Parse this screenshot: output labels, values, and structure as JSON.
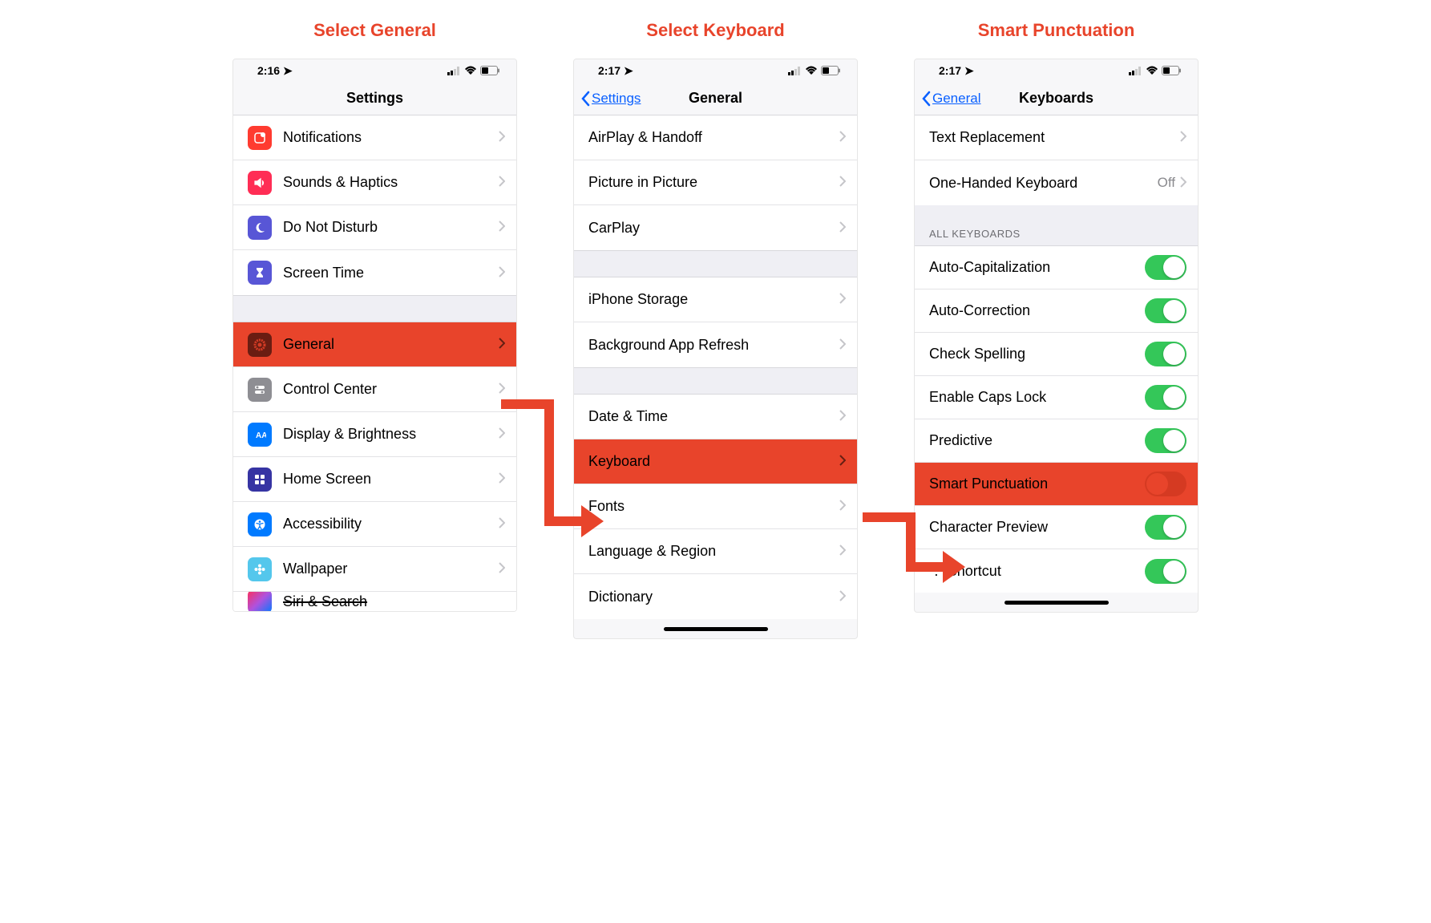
{
  "captions": {
    "c1": "Select General",
    "c2": "Select Keyboard",
    "c3": "Smart Punctuation"
  },
  "status": {
    "t1": "2:16",
    "t2": "2:17",
    "t3": "2:17"
  },
  "nav": {
    "settings_title": "Settings",
    "general_title": "General",
    "keyboards_title": "Keyboards",
    "back_settings": "Settings",
    "back_general": "General"
  },
  "screen1": {
    "notifications": "Notifications",
    "sounds": "Sounds & Haptics",
    "dnd": "Do Not Disturb",
    "screentime": "Screen Time",
    "general": "General",
    "control": "Control Center",
    "display": "Display & Brightness",
    "home": "Home Screen",
    "access": "Accessibility",
    "wallpaper": "Wallpaper",
    "siri": "Siri & Search"
  },
  "screen2": {
    "airplay": "AirPlay & Handoff",
    "pip": "Picture in Picture",
    "carplay": "CarPlay",
    "storage": "iPhone Storage",
    "bgrefresh": "Background App Refresh",
    "datetime": "Date & Time",
    "keyboard": "Keyboard",
    "fonts": "Fonts",
    "language": "Language & Region",
    "dictionary": "Dictionary"
  },
  "screen3": {
    "textrepl": "Text Replacement",
    "onehand": "One-Handed Keyboard",
    "onehand_val": "Off",
    "section": "ALL KEYBOARDS",
    "autocap": "Auto-Capitalization",
    "autocorr": "Auto-Correction",
    "spell": "Check Spelling",
    "caps": "Enable Caps Lock",
    "pred": "Predictive",
    "smart": "Smart Punctuation",
    "preview": "Character Preview",
    "shortcut": "\".\" Shortcut"
  },
  "icons": {
    "notifications": {
      "bg": "#ff3b30"
    },
    "sounds": {
      "bg": "#ff2d55"
    },
    "dnd": {
      "bg": "#5856d6"
    },
    "screentime": {
      "bg": "#5856d6"
    },
    "general": {
      "bg": "#8e8e93"
    },
    "control": {
      "bg": "#8e8e93"
    },
    "display": {
      "bg": "#007aff"
    },
    "home": {
      "bg": "#3634a3"
    },
    "access": {
      "bg": "#007aff"
    },
    "wallpaper": {
      "bg": "#54c7ec"
    },
    "siri": {
      "bg": "#1c1c1e"
    }
  }
}
